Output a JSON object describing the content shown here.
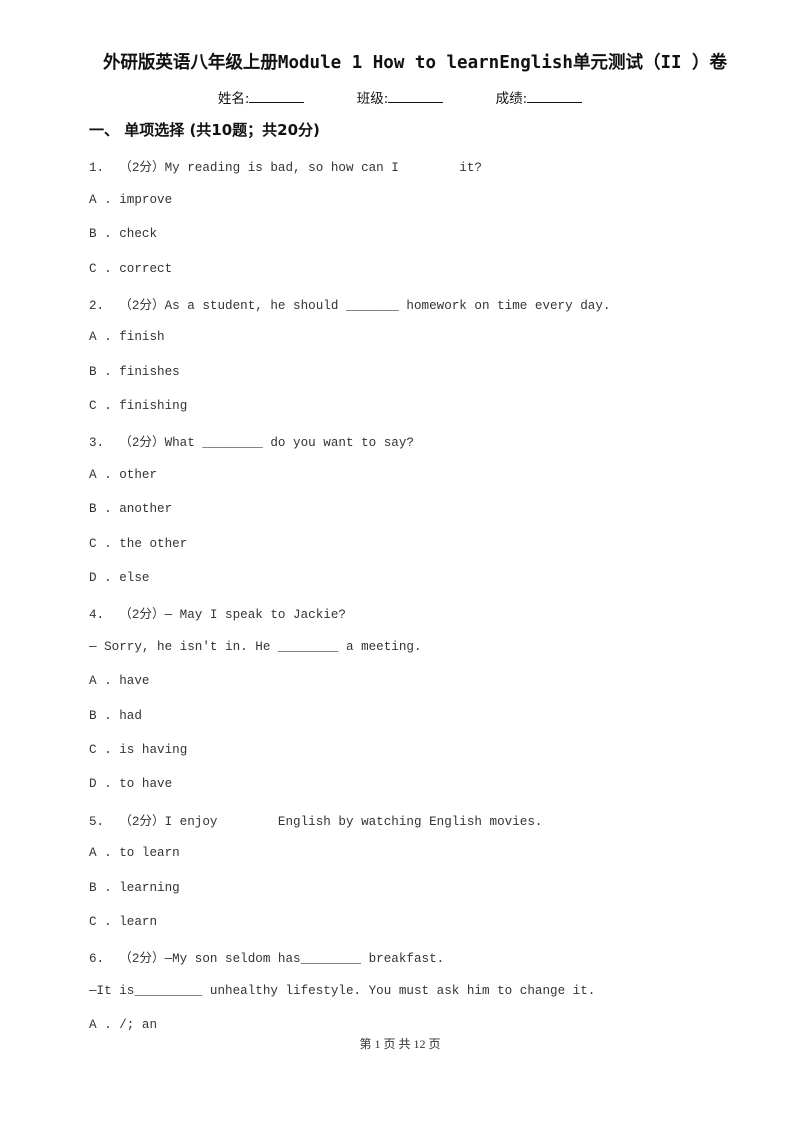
{
  "document": {
    "title": "外研版英语八年级上册Module 1 How to learnEnglish单元测试（II ）卷",
    "info_fields": [
      {
        "label": "姓名:"
      },
      {
        "label": "班级:"
      },
      {
        "label": "成绩:"
      }
    ],
    "section_heading": "一、 单项选择 (共10题；共20分)",
    "lines": [
      "1.  （2分）My reading is bad, so how can I        it?",
      "A . improve",
      "B . check",
      "C . correct",
      "2.  （2分）As a student, he should _______ homework on time every day.",
      "A . finish",
      "B . finishes",
      "C . finishing",
      "3.  （2分）What ________ do you want to say?",
      "A . other",
      "B . another",
      "C . the other",
      "D . else",
      "4.  （2分）— May I speak to Jackie?",
      "— Sorry, he isn't in. He ________ a meeting.",
      "A . have",
      "B . had",
      "C . is having",
      "D . to have",
      "5.  （2分）I enjoy        English by watching English movies.",
      "A . to learn",
      "B . learning",
      "C . learn",
      "6.  （2分）—My son seldom has________ breakfast.",
      "—It is_________ unhealthy lifestyle. You must ask him to change it.",
      "A . /; an"
    ],
    "footer": "第 1 页 共 12 页"
  }
}
